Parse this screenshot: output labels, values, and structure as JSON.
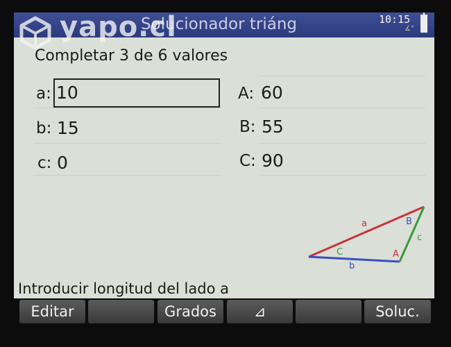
{
  "watermark": {
    "brand": "yapo.cl"
  },
  "titlebar": {
    "title": "Solucionador triáng",
    "time": "10:15",
    "angle_mode": "∡°"
  },
  "instruction": "Completar 3 de 6 valores",
  "fields": {
    "a": {
      "label": "a:",
      "value": "10"
    },
    "b": {
      "label": "b:",
      "value": "15"
    },
    "c": {
      "label": "c:",
      "value": "0"
    },
    "A": {
      "label": "A:",
      "value": "60"
    },
    "B": {
      "label": "B:",
      "value": "55"
    },
    "C": {
      "label": "C:",
      "value": "90"
    }
  },
  "diagram": {
    "side_a": "a",
    "side_b": "b",
    "side_c": "c",
    "angle_A": "A",
    "angle_B": "B",
    "angle_C": "C",
    "colors": {
      "a": "#c8323a",
      "b": "#3a4fc0",
      "c": "#3a9a3a"
    }
  },
  "status_message": "Introducir longitud del lado a",
  "menu": {
    "items": [
      "Editar",
      "",
      "Grados",
      "⊿",
      "",
      "Soluc."
    ]
  }
}
